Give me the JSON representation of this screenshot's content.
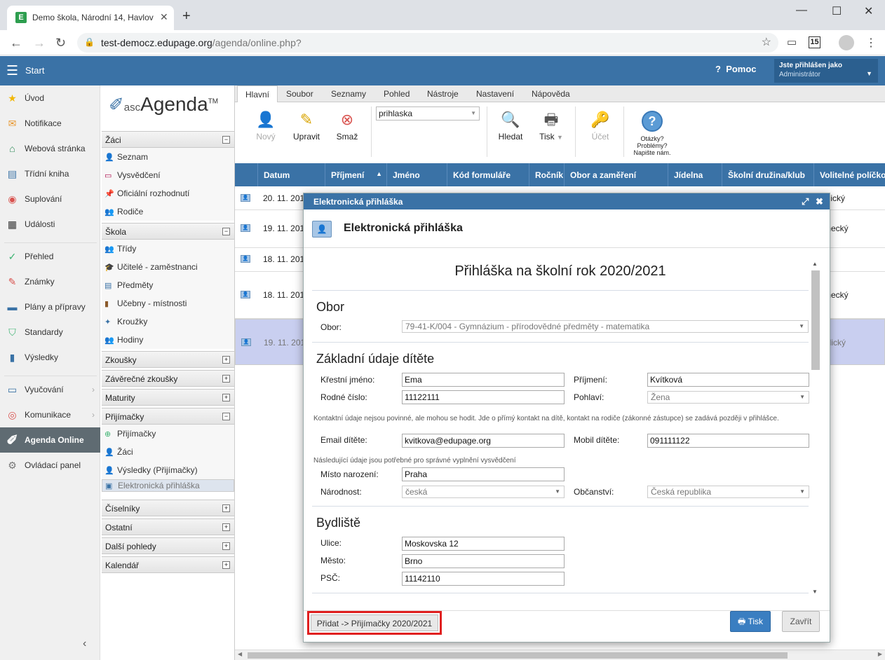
{
  "browser": {
    "tab_title": "Demo škola, Národní 14, Havlov",
    "url_host": "test-democz.edupage.org",
    "url_path": "/agenda/online.php?",
    "ext_badge": "15"
  },
  "header": {
    "start": "Start",
    "help": "Pomoc",
    "user_line1": "Jste přihlášen jako",
    "user_line2": "Administrátor"
  },
  "leftnav": [
    {
      "label": "Úvod",
      "icon": "★"
    },
    {
      "label": "Notifikace",
      "icon": "✉"
    },
    {
      "label": "Webová stránka",
      "icon": "⌂"
    },
    {
      "label": "Třídní kniha",
      "icon": "▤"
    },
    {
      "label": "Suplování",
      "icon": "◉"
    },
    {
      "label": "Události",
      "icon": "▦"
    },
    {
      "label": "Přehled",
      "icon": "✓"
    },
    {
      "label": "Známky",
      "icon": "✎"
    },
    {
      "label": "Plány a přípravy",
      "icon": "▬"
    },
    {
      "label": "Standardy",
      "icon": "⛉"
    },
    {
      "label": "Výsledky",
      "icon": "▮"
    },
    {
      "label": "Vyučování",
      "icon": "▭"
    },
    {
      "label": "Komunikace",
      "icon": "◎"
    },
    {
      "label": "Agenda Online",
      "icon": "✐"
    },
    {
      "label": "Ovládací panel",
      "icon": "⚙"
    }
  ],
  "logo": {
    "asc": "asc",
    "name": "Agenda",
    "tm": "TM"
  },
  "sections": {
    "zaci": "Žáci",
    "seznam": "Seznam",
    "vysvedceni": "Vysvědčení",
    "oficialni": "Oficiální rozhodnutí",
    "rodice": "Rodiče",
    "skola": "Škola",
    "tridy": "Třídy",
    "ucitele": "Učitelé - zaměstnanci",
    "predmety": "Předměty",
    "ucebny": "Učebny - místnosti",
    "krouzky": "Kroužky",
    "hodiny": "Hodiny",
    "zkousky": "Zkoušky",
    "zaverecne": "Závěrečné zkoušky",
    "maturity": "Maturity",
    "prijimacky": "Přijímačky",
    "prijimacky_item": "Přijímačky",
    "prij_zaci": "Žáci",
    "prij_vysledky": "Výsledky (Přijímačky)",
    "elektronicka": "Elektronická přihláška",
    "ciselniky": "Číselníky",
    "ostatni": "Ostatní",
    "dalsi": "Další pohledy",
    "kalendar": "Kalendář"
  },
  "ribbon": {
    "tabs": [
      "Hlavní",
      "Soubor",
      "Seznamy",
      "Pohled",
      "Nástroje",
      "Nastavení",
      "Nápověda"
    ],
    "novy": "Nový",
    "upravit": "Upravit",
    "smaz": "Smaž",
    "form_select": "prihlaska",
    "hledat": "Hledat",
    "tisk": "Tisk",
    "ucet": "Účet",
    "help_text": "Otázky? Problémy? Napište nám."
  },
  "grid": {
    "columns": [
      "Datum",
      "Příjmení",
      "Jméno",
      "Kód formuláře",
      "Ročník",
      "Obor a zaměření",
      "Jídelna",
      "Školní družina/klub",
      "Volitelné políčko"
    ],
    "rows": [
      {
        "date": "20. 11. 201",
        "extra": "glický"
      },
      {
        "date": "19. 11. 201",
        "extra": "mecký"
      },
      {
        "date": "18. 11. 201",
        "extra": ""
      },
      {
        "date": "18. 11. 201",
        "extra": "mecký"
      },
      {
        "date": "19. 11. 201",
        "extra": "glický"
      }
    ]
  },
  "dialog": {
    "bar_title": "Elektronická přihláška",
    "head_title": "Elektronická přihláška",
    "form_title": "Přihláška na školní rok 2020/2021",
    "obor_section": "Obor",
    "obor_label": "Obor:",
    "obor_value": "79-41-K/004 - Gymnázium - přírodovědné předměty - matematika",
    "zakladni_section": "Základní údaje dítěte",
    "krestni_label": "Křestní jméno:",
    "krestni_value": "Ema",
    "prijmeni_label": "Příjmení:",
    "prijmeni_value": "Kvítková",
    "rodne_label": "Rodné číslo:",
    "rodne_value": "11122111",
    "pohlavi_label": "Pohlaví:",
    "pohlavi_value": "Žena",
    "contact_note": "Kontaktní údaje nejsou povinné, ale mohou se hodit. Jde o přímý kontakt na dítě, kontakt na rodiče (zákonné zástupce) se zadává později v přihlášce.",
    "email_label": "Email dítěte:",
    "email_value": "kvitkova@edupage.org",
    "mobil_label": "Mobil dítěte:",
    "mobil_value": "091111122",
    "cert_note": "Následující údaje jsou potřebné pro správné vyplnění vysvědčení",
    "misto_label": "Místo narození:",
    "misto_value": "Praha",
    "narodnost_label": "Národnost:",
    "narodnost_value": "česká",
    "obcanstvi_label": "Občanství:",
    "obcanstvi_value": "Česká republika",
    "bydliste_section": "Bydliště",
    "ulice_label": "Ulice:",
    "ulice_value": "Moskovska 12",
    "mesto_label": "Město:",
    "mesto_value": "Brno",
    "psc_label": "PSČ:",
    "psc_value": "11142110",
    "add_button": "Přidat -> Přijímačky 2020/2021",
    "print_button": "Tisk",
    "close_button": "Zavřít"
  }
}
